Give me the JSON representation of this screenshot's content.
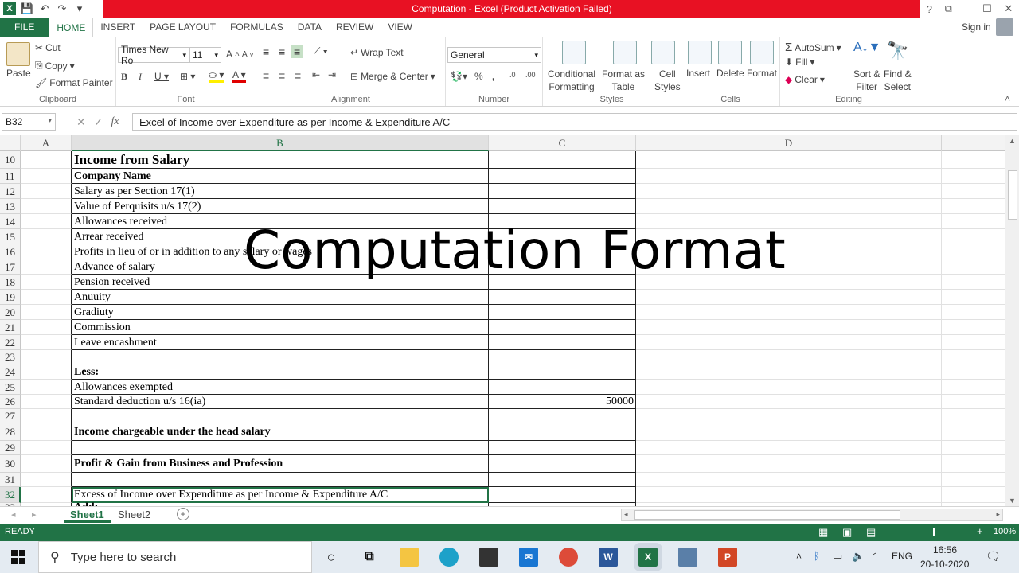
{
  "window": {
    "title": "Computation  -  Excel (Product Activation Failed)",
    "help": "?",
    "restore": "⧉",
    "minimize": "–",
    "maximize": "☐",
    "close": "✕"
  },
  "tabs": [
    "FILE",
    "HOME",
    "INSERT",
    "PAGE LAYOUT",
    "FORMULAS",
    "DATA",
    "REVIEW",
    "VIEW"
  ],
  "signin": "Sign in",
  "ribbon": {
    "clipboard": {
      "paste": "Paste",
      "cut": "Cut",
      "copy": "Copy",
      "format_painter": "Format Painter",
      "label": "Clipboard"
    },
    "font": {
      "name": "Times New Ro",
      "size": "11",
      "label": "Font"
    },
    "alignment": {
      "wrap": "Wrap Text",
      "merge": "Merge & Center",
      "label": "Alignment"
    },
    "number": {
      "format": "General",
      "label": "Number"
    },
    "styles": {
      "cond1": "Conditional",
      "cond2": "Formatting",
      "fmt1": "Format as",
      "fmt2": "Table",
      "cell1": "Cell",
      "cell2": "Styles",
      "label": "Styles"
    },
    "cells": {
      "insert": "Insert",
      "delete": "Delete",
      "format": "Format",
      "label": "Cells"
    },
    "editing": {
      "autosum": "AutoSum",
      "fill": "Fill",
      "clear": "Clear",
      "sort1": "Sort &",
      "sort2": "Filter",
      "find1": "Find &",
      "find2": "Select",
      "label": "Editing"
    }
  },
  "formula_bar": {
    "name_box": "B32",
    "fx": "fx",
    "value": "Excel of Income over Expenditure as per Income & Expenditure A/C"
  },
  "columns": [
    "A",
    "B",
    "C",
    "D"
  ],
  "rows": [
    {
      "n": "10",
      "b": "Income from Salary",
      "c": ""
    },
    {
      "n": "11",
      "b": "Company Name",
      "c": ""
    },
    {
      "n": "12",
      "b": "Salary as per Section 17(1)",
      "c": ""
    },
    {
      "n": "13",
      "b": "Value of Perquisits u/s 17(2)",
      "c": ""
    },
    {
      "n": "14",
      "b": "Allowances received",
      "c": ""
    },
    {
      "n": "15",
      "b": "Arrear received",
      "c": ""
    },
    {
      "n": "16",
      "b": "Profits in lieu of or in addition to any salary or wages",
      "c": ""
    },
    {
      "n": "17",
      "b": "Advance of salary",
      "c": ""
    },
    {
      "n": "18",
      "b": "Pension received",
      "c": ""
    },
    {
      "n": "19",
      "b": "Anuuity",
      "c": ""
    },
    {
      "n": "20",
      "b": "Gradiuty",
      "c": ""
    },
    {
      "n": "21",
      "b": "Commission",
      "c": ""
    },
    {
      "n": "22",
      "b": "Leave encashment",
      "c": ""
    },
    {
      "n": "23",
      "b": "",
      "c": ""
    },
    {
      "n": "24",
      "b": "Less:",
      "c": ""
    },
    {
      "n": "25",
      "b": "Allowances exempted",
      "c": ""
    },
    {
      "n": "26",
      "b": "Standard deduction u/s 16(ia)",
      "c": "50000"
    },
    {
      "n": "27",
      "b": "",
      "c": ""
    },
    {
      "n": "28",
      "b": "Income chargeable under the head salary",
      "c": ""
    },
    {
      "n": "29",
      "b": "",
      "c": ""
    },
    {
      "n": "30",
      "b": "Profit & Gain from Business and Profession",
      "c": ""
    },
    {
      "n": "31",
      "b": "",
      "c": ""
    },
    {
      "n": "32",
      "b": "Excess of Income over Expenditure as per Income & Expenditure A/C",
      "c": ""
    },
    {
      "n": "33",
      "b": "Add:",
      "c": ""
    }
  ],
  "overlay_text": "Computation Format",
  "sheets": [
    "Sheet1",
    "Sheet2"
  ],
  "status": {
    "mode": "READY",
    "zoom": "100%"
  },
  "taskbar": {
    "search_placeholder": "Type here to search",
    "lang": "ENG",
    "time": "16:56",
    "date": "20-10-2020"
  }
}
